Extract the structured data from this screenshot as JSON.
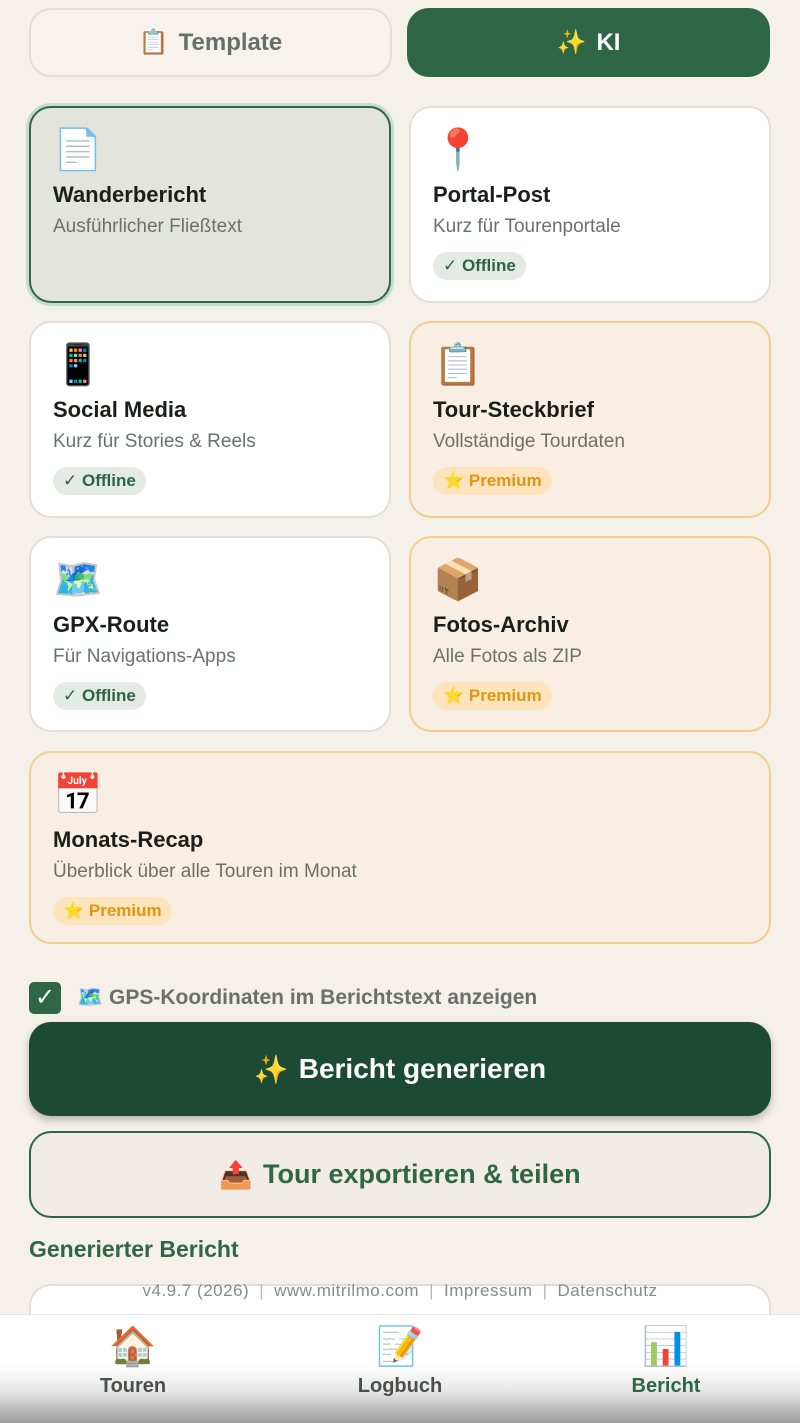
{
  "mode_toggle": {
    "template": {
      "icon": "📋",
      "label": "Template"
    },
    "ki": {
      "icon": "✨",
      "label": "KI"
    }
  },
  "report_types": [
    {
      "icon": "📄",
      "title": "Wanderbericht",
      "subtitle": "Ausführlicher Fließtext",
      "badge": ""
    },
    {
      "icon": "📍",
      "title": "Portal-Post",
      "subtitle": "Kurz für Tourenportale",
      "badge": "✓ Offline"
    },
    {
      "icon": "📱",
      "title": "Social Media",
      "subtitle": "Kurz für Stories & Reels",
      "badge": "✓ Offline"
    },
    {
      "icon": "📋",
      "title": "Tour-Steckbrief",
      "subtitle": "Vollständige Tourdaten",
      "badge": "⭐ Premium"
    },
    {
      "icon": "🗺️",
      "title": "GPX-Route",
      "subtitle": "Für Navigations-Apps",
      "badge": "✓ Offline"
    },
    {
      "icon": "📦",
      "title": "Fotos-Archiv",
      "subtitle": "Alle Fotos als ZIP",
      "badge": "⭐ Premium"
    },
    {
      "icon": "📅",
      "title": "Monats-Recap",
      "subtitle": "Überblick über alle Touren im Monat",
      "badge": "⭐ Premium"
    }
  ],
  "gps_option": {
    "checked_mark": "✓",
    "icon": "🗺️",
    "label": "GPS-Koordinaten im Berichtstext anzeigen"
  },
  "generate_button": {
    "icon": "✨",
    "label": "Bericht generieren"
  },
  "export_button": {
    "icon": "📤",
    "label": "Tour exportieren & teilen"
  },
  "report_section": {
    "heading": "Generierter Bericht"
  },
  "footer": {
    "version": "v4.9.7 (2026)",
    "website": "www.mitrilmo.com",
    "imprint": "Impressum",
    "privacy": "Datenschutz",
    "separator": "|"
  },
  "bottom_nav": [
    {
      "icon": "🏠",
      "label": "Touren"
    },
    {
      "icon": "📝",
      "label": "Logbuch"
    },
    {
      "icon": "📊",
      "label": "Bericht"
    }
  ],
  "colors": {
    "primary": "#2e6647",
    "primary_dark": "#1d4a34",
    "background": "#f5f0e9",
    "premium_text": "#e0960f",
    "premium_border": "#f2cf8c"
  }
}
